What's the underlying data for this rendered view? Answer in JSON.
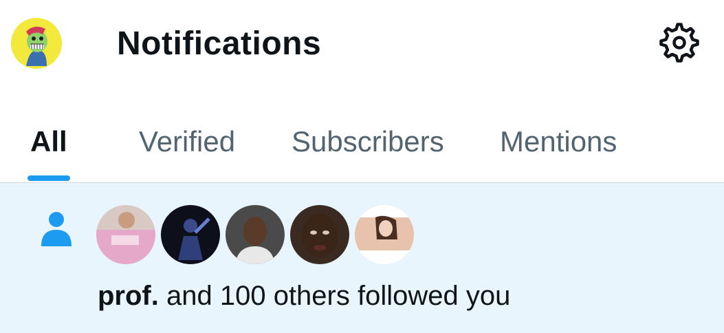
{
  "header": {
    "title": "Notifications",
    "avatar_icon": "profile-avatar",
    "settings_icon": "gear-icon"
  },
  "tabs": [
    {
      "label": "All",
      "active": true
    },
    {
      "label": "Verified",
      "active": false
    },
    {
      "label": "Subscribers",
      "active": false
    },
    {
      "label": "Mentions",
      "active": false
    }
  ],
  "notification": {
    "icon": "person-icon",
    "user_bold": "prof.",
    "message": " and 100 others followed you",
    "avatars": [
      "follower-avatar-1",
      "follower-avatar-2",
      "follower-avatar-3",
      "follower-avatar-4",
      "follower-avatar-5"
    ]
  },
  "colors": {
    "accent": "#1d9bf0",
    "highlight_bg": "#e8f5fd",
    "muted_text": "#536471"
  }
}
